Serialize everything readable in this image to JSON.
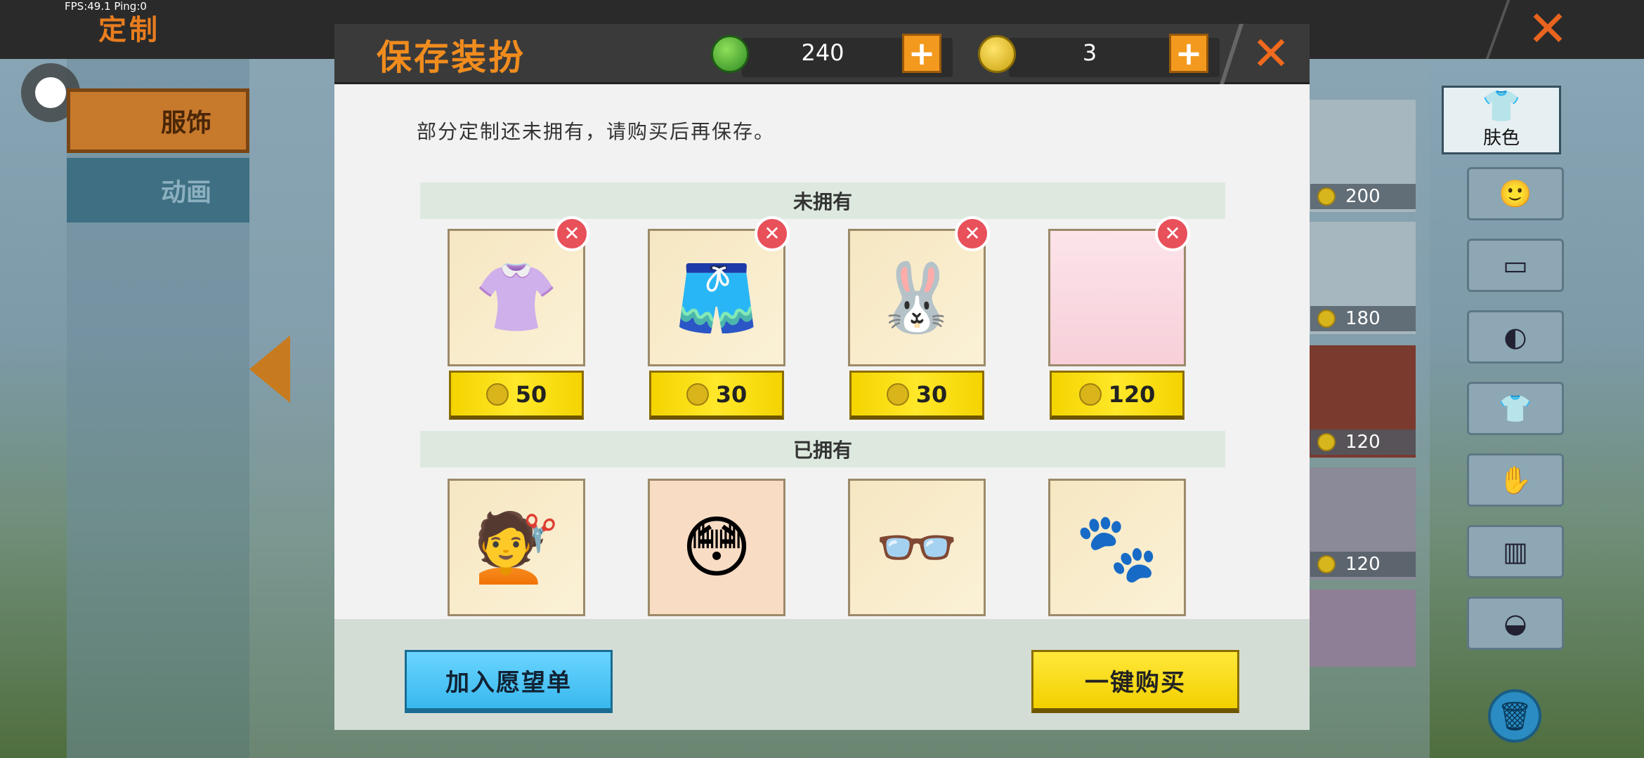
{
  "status": {
    "fps_text": "FPS:49.1  Ping:0"
  },
  "background": {
    "page_title": "定制",
    "tabs": [
      {
        "label": "服饰",
        "active": true
      },
      {
        "label": "动画",
        "active": false
      }
    ],
    "shop_prices": [
      "200",
      "180",
      "120",
      "120"
    ],
    "rail": {
      "skin_label": "肤色",
      "items": [
        "face-icon",
        "head-icon",
        "mask-icon",
        "shirt-icon",
        "gloves-icon",
        "pants-icon",
        "shoes-icon"
      ]
    }
  },
  "modal": {
    "title": "保存装扮",
    "currency": {
      "gems": "240",
      "coins": "3"
    },
    "notice": "部分定制还未拥有，请购买后再保存。",
    "unowned_header": "未拥有",
    "owned_header": "已拥有",
    "unowned_items": [
      {
        "name": "sailor-uniform-top",
        "icon": "👚",
        "price": "50"
      },
      {
        "name": "plaid-skirt",
        "icon": "🩳",
        "price": "30"
      },
      {
        "name": "bunny-slippers-effect",
        "icon": "🐰",
        "price": "30"
      },
      {
        "name": "pink-background",
        "icon": "",
        "price": "120"
      }
    ],
    "owned_items": [
      {
        "name": "brown-braided-hair",
        "icon": "💇"
      },
      {
        "name": "blushing-face",
        "icon": "😳"
      },
      {
        "name": "round-glasses",
        "icon": "👓"
      },
      {
        "name": "cat-paw-gloves",
        "icon": "🐾"
      }
    ],
    "buttons": {
      "wishlist": "加入愿望单",
      "buy_all": "一键购买"
    },
    "colors": {
      "accent": "#f08c1e",
      "price_yellow": "#ffe82a",
      "remove_red": "#e8505a",
      "wishlist_blue": "#38b8ee"
    }
  }
}
